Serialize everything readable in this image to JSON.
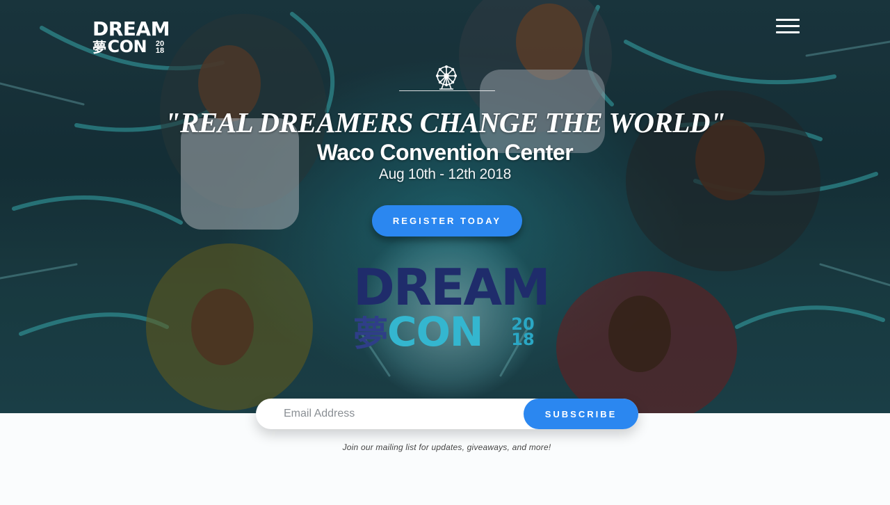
{
  "brand": {
    "logo_line1": "DREAM",
    "logo_kanji": "夢",
    "logo_line2": "CON",
    "logo_year_top": "20",
    "logo_year_bottom": "18"
  },
  "nav": {
    "menu_icon": "hamburger-menu-icon"
  },
  "hero": {
    "icon": "ferris-wheel-icon",
    "tagline": "\"REAL DREAMERS CHANGE THE WORLD\"",
    "venue": "Waco Convention Center",
    "dates": "Aug 10th - 12th 2018",
    "register_label": "REGISTER TODAY",
    "big_logo_line1": "DREAM",
    "big_logo_kanji": "夢",
    "big_logo_line2": "CON",
    "big_logo_year_top": "20",
    "big_logo_year_bottom": "18"
  },
  "subscribe": {
    "email_placeholder": "Email Address",
    "button_label": "SUBSCRIBE",
    "note": "Join our mailing list for updates, giveaways, and more!"
  },
  "colors": {
    "accent": "#2b87f0",
    "logo_navy": "#1f2c6b",
    "logo_teal": "#34b6cf",
    "footer_bg": "#fafcfd"
  }
}
